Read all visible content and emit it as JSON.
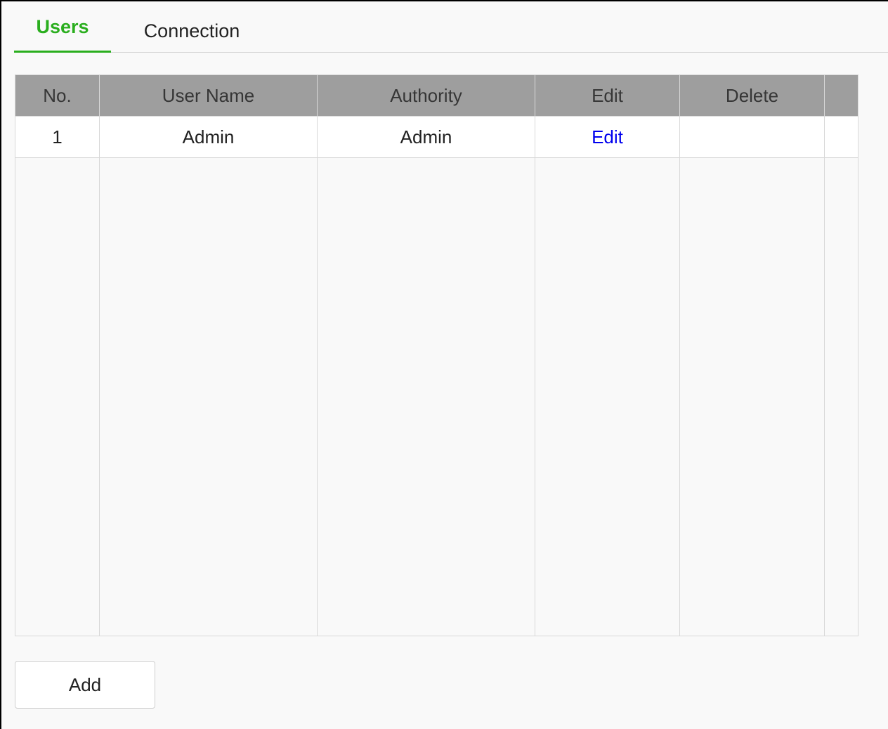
{
  "tabs": [
    {
      "label": "Users",
      "active": true
    },
    {
      "label": "Connection",
      "active": false
    }
  ],
  "accent_color": "#2aae1e",
  "table": {
    "headers": [
      "No.",
      "User Name",
      "Authority",
      "Edit",
      "Delete",
      ""
    ],
    "rows": [
      {
        "no": "1",
        "user_name": "Admin",
        "authority": "Admin",
        "edit": "Edit",
        "delete": ""
      }
    ]
  },
  "add_button": {
    "label": "Add"
  }
}
